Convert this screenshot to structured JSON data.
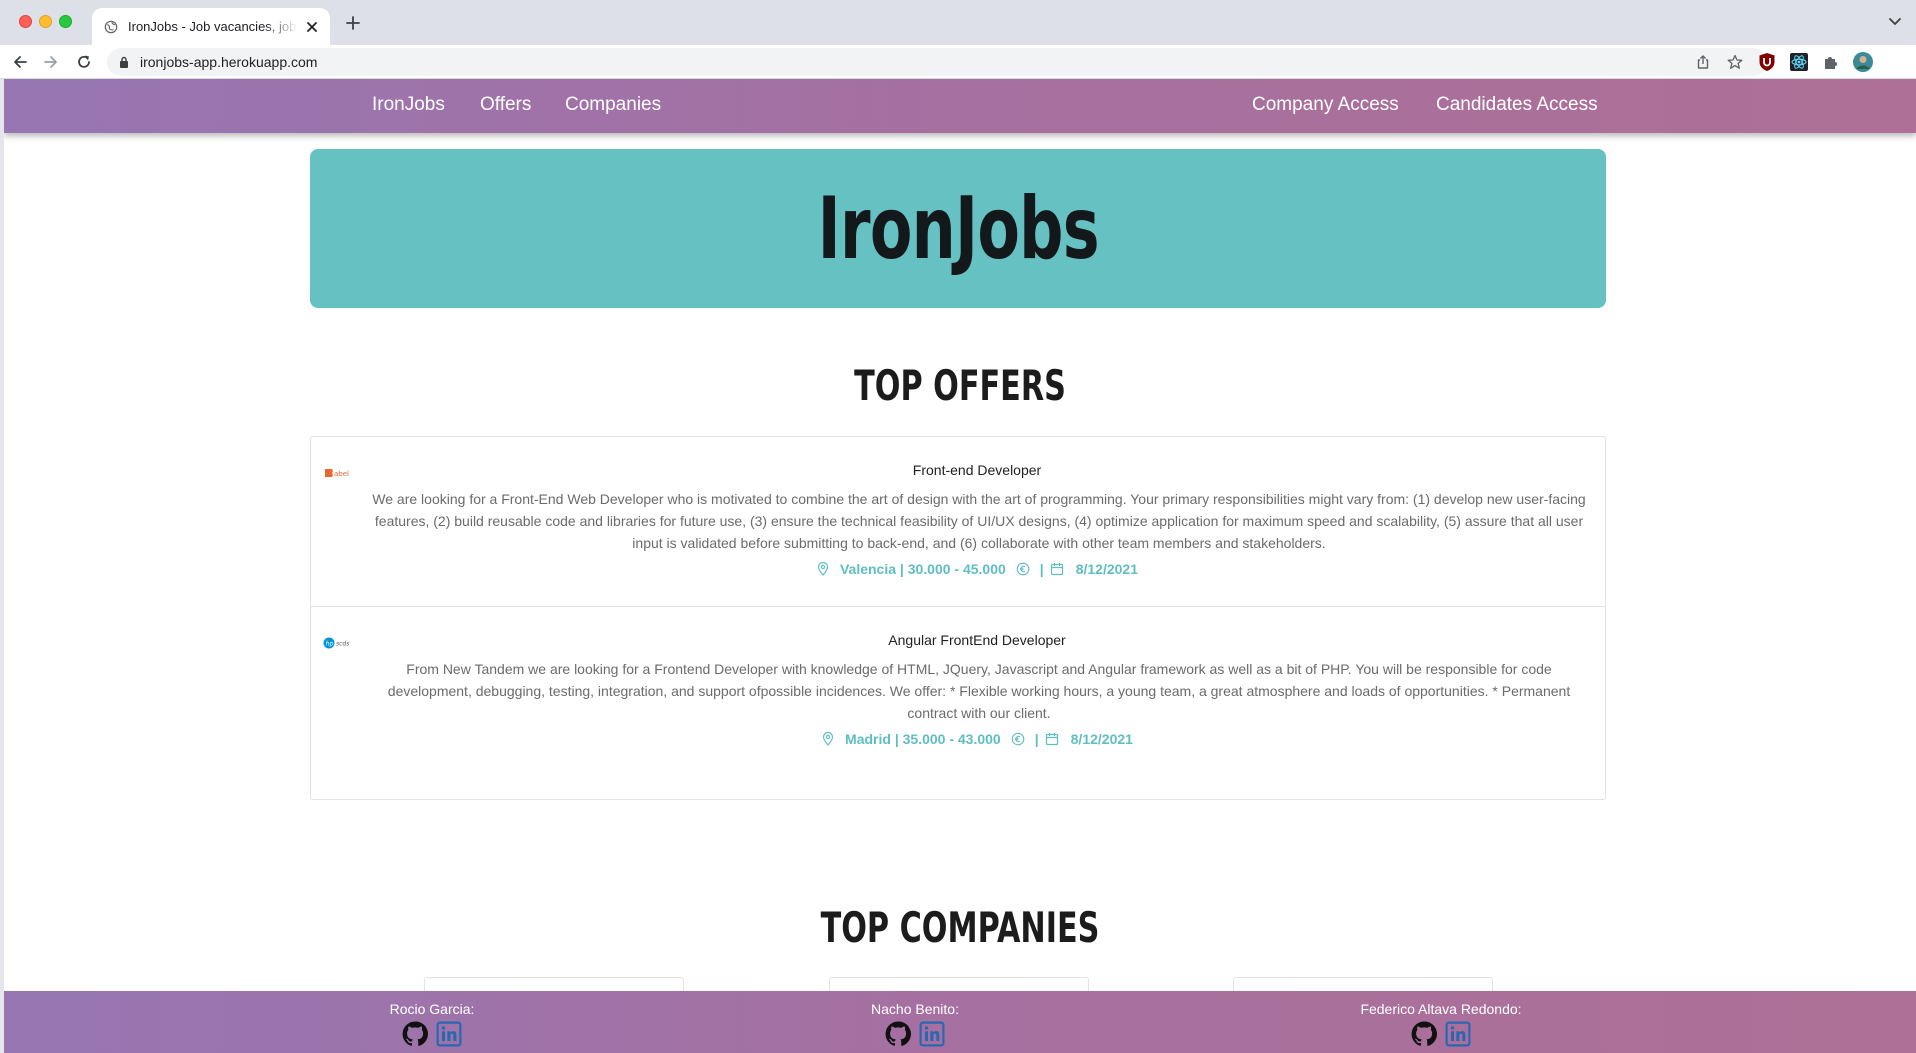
{
  "browser": {
    "tab_title": "IronJobs - Job vacancies, job offers",
    "url": "ironjobs-app.herokuapp.com"
  },
  "navbar": {
    "brand": "IronJobs",
    "offers": "Offers",
    "companies": "Companies",
    "company_access": "Company Access",
    "candidates_access": "Candidates Access"
  },
  "hero": {
    "title": "IronJobs"
  },
  "top_offers": {
    "heading": "TOP OFFERS",
    "offers": [
      {
        "logo_icon": "babel-logo-icon",
        "title": "Front-end Developer",
        "description": "We are looking for a Front-End Web Developer who is motivated to combine the art of design with the art of programming. Your primary responsibilities might vary from: (1) develop new user-facing features, (2) build reusable code and libraries for future use, (3) ensure the technical feasibility of UI/UX designs, (4) optimize application for maximum speed and scalability, (5) assure that all user input is validated before submitting to back-end, and (6) collaborate with other team members and stakeholders.",
        "location_salary": "Valencia | 30.000 - 45.000",
        "separator": "|",
        "date": "8/12/2021"
      },
      {
        "logo_icon": "hp-scds-logo-icon",
        "title": "Angular FrontEnd Developer",
        "description": "From New Tandem we are looking for a Frontend Developer with knowledge of HTML, JQuery, Javascript and Angular framework as well as a bit of PHP. You will be responsible for code development, debugging, testing, integration, and support ofpossible incidences. We offer: * Flexible working hours, a young team, a great atmosphere and loads of opportunities. * Permanent contract with our client.",
        "location_salary": "Madrid | 35.000 - 43.000",
        "separator": "|",
        "date": "8/12/2021"
      }
    ]
  },
  "top_companies": {
    "heading": "TOP COMPANIES"
  },
  "footer": {
    "authors": [
      {
        "name": "Rocio Garcia:"
      },
      {
        "name": "Nacho Benito:"
      },
      {
        "name": "Federico Altava Redondo:"
      }
    ]
  },
  "colors": {
    "navbar_start": "#9776b3",
    "navbar_end": "#ae7096",
    "hero_bg": "#66c1c3",
    "meta_teal": "#5fbec2",
    "linkedin_blue": "#2867b2"
  }
}
